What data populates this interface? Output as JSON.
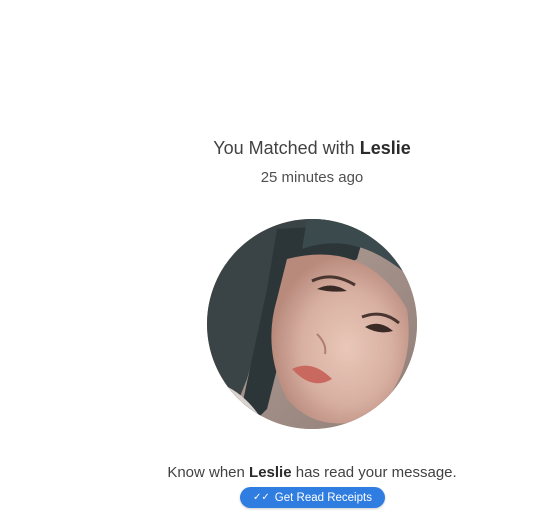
{
  "match": {
    "title_prefix": "You Matched with",
    "name": "Leslie",
    "time_ago": "25 minutes ago"
  },
  "read_receipts": {
    "know_prefix": "Know when",
    "name": "Leslie",
    "know_suffix": "has read your message.",
    "button_label": "Get Read Receipts",
    "button_icon": "double-check-icon",
    "button_color": "#2f7de1"
  },
  "avatar": {
    "icon": "profile-photo"
  }
}
